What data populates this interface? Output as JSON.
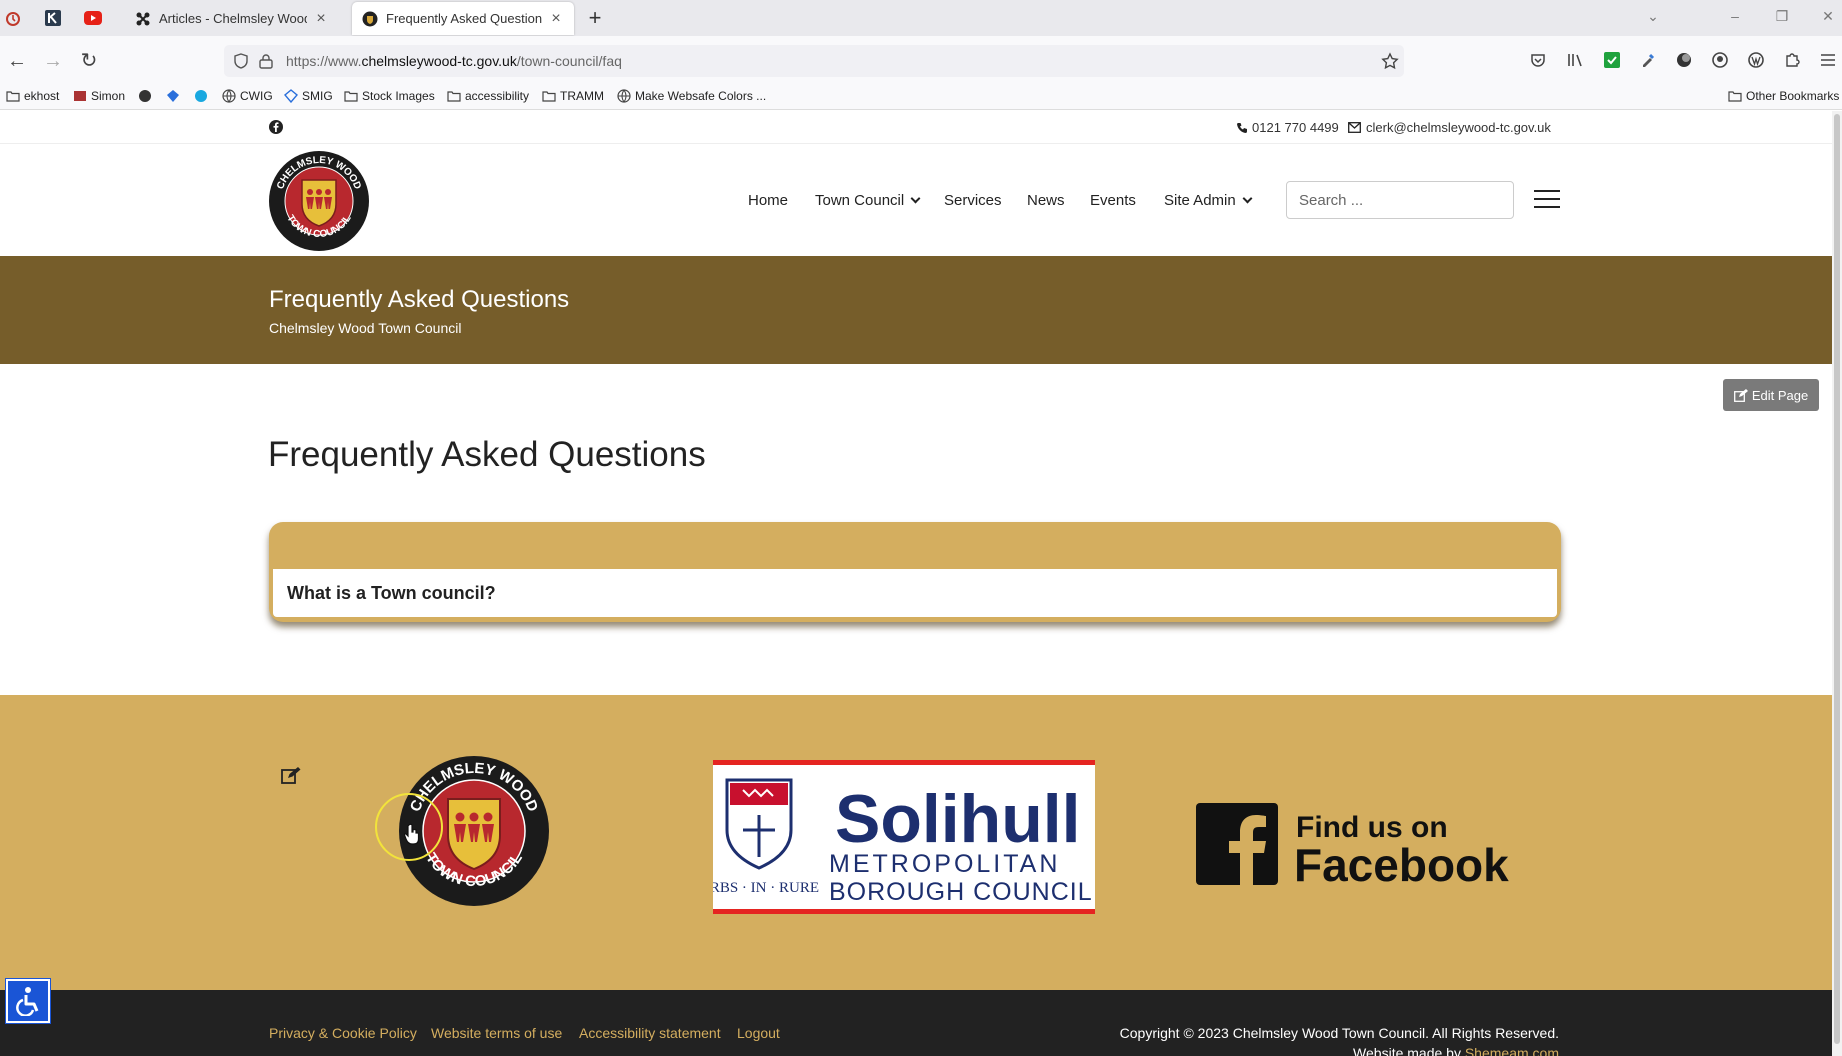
{
  "browser": {
    "tabs": [
      {
        "label": "Articles - Chelmsley Wood Tow",
        "active": false
      },
      {
        "label": "Frequently Asked Questions - C",
        "active": true
      }
    ],
    "url_prefix": "https://www.",
    "url_domain": "chelmsleywood-tc.gov.uk",
    "url_path": "/town-council/faq",
    "bookmarks": [
      "ekhost",
      "Simon",
      "CWIG",
      "SMIG",
      "Stock Images",
      "accessibility",
      "TRAMM",
      "Make Websafe Colors ..."
    ],
    "other_bookmarks": "Other Bookmarks"
  },
  "site": {
    "phone": "0121 770 4499",
    "email": "clerk@chelmsleywood-tc.gov.uk",
    "logo_text_top": "CHELMSLEY WOOD",
    "logo_text_bottom": "TOWN COUNCIL",
    "nav": {
      "home": "Home",
      "town_council": "Town Council",
      "services": "Services",
      "news": "News",
      "events": "Events",
      "site_admin": "Site Admin"
    },
    "search_placeholder": "Search ..."
  },
  "banner": {
    "title": "Frequently Asked Questions",
    "subtitle": "Chelmsley Wood Town Council"
  },
  "edit_page_label": "Edit Page",
  "page_title": "Frequently Asked Questions",
  "faq": [
    {
      "question": "What is a Town council?"
    }
  ],
  "footer": {
    "solihull_name": "Solihull",
    "solihull_line1": "METROPOLITAN",
    "solihull_line2": "BOROUGH COUNCIL",
    "solihull_motto": "URBS · IN · RURE",
    "fb_line1": "Find us on",
    "fb_line2": "Facebook",
    "links": [
      "Privacy & Cookie Policy",
      "Website terms of use",
      "Accessibility statement",
      "Logout"
    ],
    "copyright": "Copyright © 2023 Chelmsley Wood Town Council. All Rights Reserved.",
    "made_by_prefix": "Website made by ",
    "made_by_link": "Shemeam.com"
  },
  "colors": {
    "banner": "#765d2a",
    "gold": "#d4ae5f",
    "footer_bar": "#222222",
    "accessibility_button": "#1a55d6"
  }
}
